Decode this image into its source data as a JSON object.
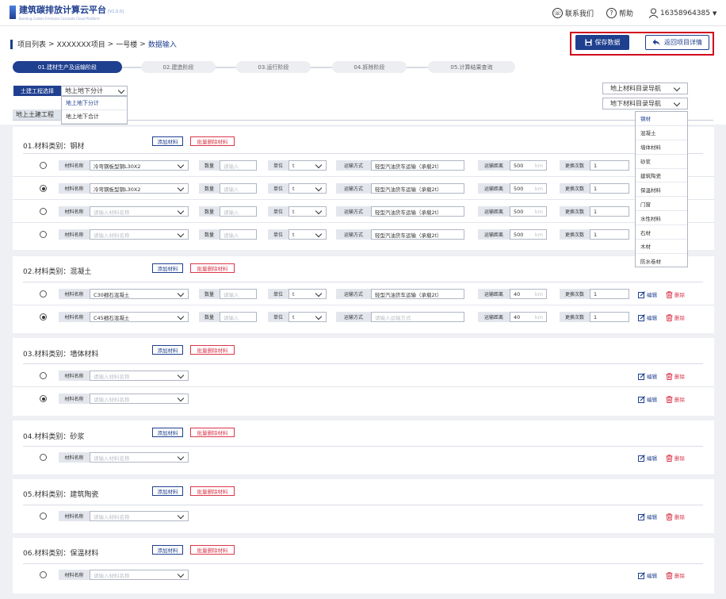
{
  "header": {
    "app_title": "建筑碳排放计算云平台",
    "app_version": "[V1.0.0]",
    "app_subtitle": "Building Carbon Emission Calculate Cloud Platform",
    "contact": "联系我们",
    "help": "帮助",
    "user": "16358964385"
  },
  "breadcrumb": {
    "project_list": "项目列表",
    "project": "XXXXXXX项目",
    "building": "一号楼",
    "current": "数据输入",
    "separator": ">"
  },
  "actions": {
    "save": "保存数据",
    "back": "返回项目详情"
  },
  "stages": [
    {
      "label": "01.建材生产及运输阶段",
      "active": true
    },
    {
      "label": "02.建造阶段",
      "active": false
    },
    {
      "label": "03.运行阶段",
      "active": false
    },
    {
      "label": "04.拆除阶段",
      "active": false
    },
    {
      "label": "05.计算结果查询",
      "active": false
    }
  ],
  "project_select": {
    "label": "土建工程选择",
    "value": "地上地下分计",
    "options": [
      "地上地下分计",
      "地上地下合计"
    ]
  },
  "section_title": "地上土建工程",
  "nav": {
    "above_ground": "地上材料目录导航",
    "below_ground": "地下材料目录导航",
    "items": [
      "钢材",
      "混凝土",
      "墙体材料",
      "砂浆",
      "建筑陶瓷",
      "保温材料",
      "门窗",
      "水性材料",
      "石材",
      "木材",
      "防水卷材"
    ]
  },
  "field_labels": {
    "name": "材料名称",
    "qty": "数量",
    "unit": "单位",
    "transport": "运输方式",
    "distance": "运输距离",
    "replace": "更换次数",
    "km": "km"
  },
  "placeholders": {
    "name": "请输入材料名称",
    "qty": "请输入",
    "transport": "请输入运输方式"
  },
  "buttons": {
    "add": "添加材料",
    "batch_delete": "批量删除材料",
    "edit": "编辑",
    "delete": "删除"
  },
  "categories": [
    {
      "title": "01.材料类别：钢材",
      "rows": [
        {
          "selected": false,
          "name": "冷弯钢板型钢L30X2",
          "unit": "t",
          "transport": "轻型汽油货车运输（承载2t）",
          "distance": "500",
          "replace": "1"
        },
        {
          "selected": true,
          "name": "冷弯钢板型钢L30X2",
          "unit": "t",
          "transport": "轻型汽油货车运输（承载2t）",
          "distance": "500",
          "replace": "1"
        },
        {
          "selected": false,
          "name": "",
          "unit": "t",
          "transport": "轻型汽油货车运输（承载2t）",
          "distance": "500",
          "replace": "1"
        },
        {
          "selected": false,
          "name": "",
          "unit": "t",
          "transport": "轻型汽油货车运输（承载2t）",
          "distance": "500",
          "replace": "1"
        }
      ]
    },
    {
      "title": "02.材料类别：混凝土",
      "rows": [
        {
          "selected": false,
          "name": "C30细石混凝土",
          "unit": "t",
          "transport": "轻型汽油货车运输（承载2t）",
          "distance": "40",
          "replace": "1"
        },
        {
          "selected": true,
          "name": "C45细石混凝土",
          "unit": "t",
          "transport": "",
          "distance": "40",
          "replace": "1"
        }
      ]
    },
    {
      "title": "03.材料类别：墙体材料",
      "rows": [
        {
          "selected": false,
          "name": ""
        },
        {
          "selected": true,
          "name": ""
        }
      ]
    },
    {
      "title": "04.材料类别：砂浆",
      "rows": [
        {
          "selected": false,
          "name": ""
        }
      ]
    },
    {
      "title": "05.材料类别：建筑陶瓷",
      "rows": [
        {
          "selected": false,
          "name": ""
        }
      ]
    },
    {
      "title": "06.材料类别：保温材料",
      "rows": [
        {
          "selected": false,
          "name": ""
        }
      ]
    }
  ]
}
